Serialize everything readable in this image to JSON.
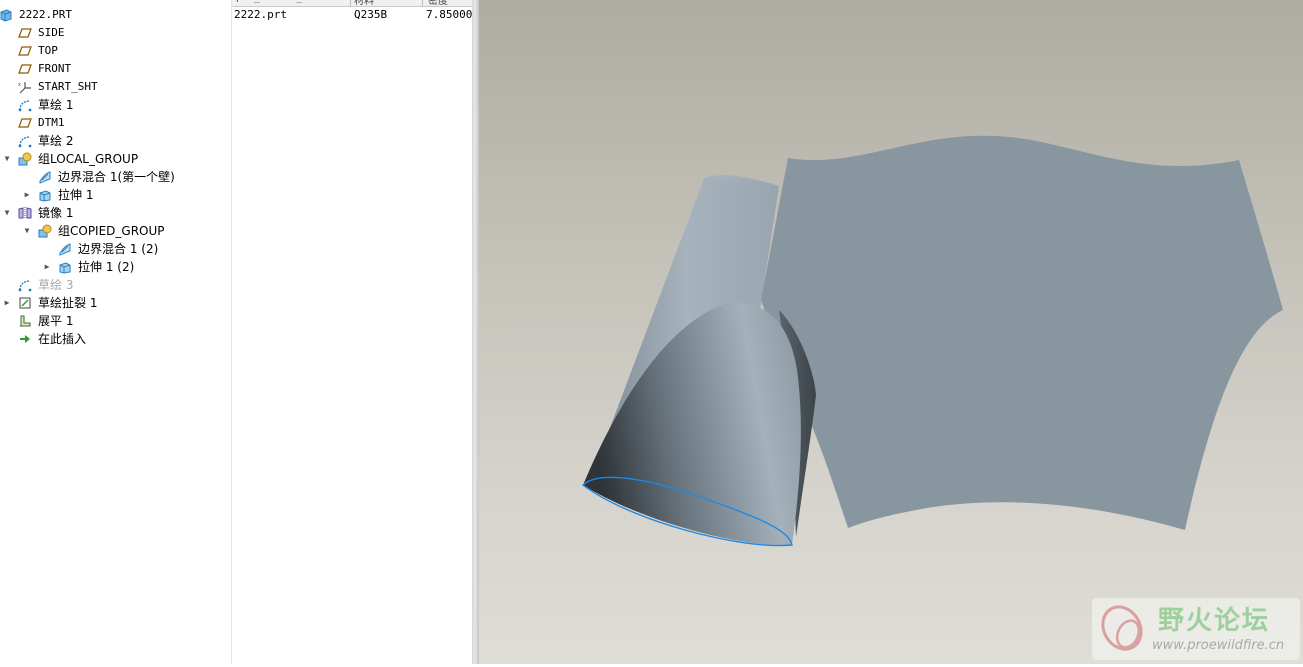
{
  "model_tree": {
    "columns": [
      "ptc_common_name",
      "材料",
      "密度"
    ],
    "items": [
      {
        "label": "2222.PRT",
        "icon": "part-icon",
        "indent": 0,
        "expander": "none",
        "name_value": "2222.prt",
        "material": "Q235B",
        "density": "7.850000"
      },
      {
        "label": "SIDE",
        "icon": "datum-plane-icon",
        "indent": 1,
        "expander": "none"
      },
      {
        "label": "TOP",
        "icon": "datum-plane-icon",
        "indent": 1,
        "expander": "none"
      },
      {
        "label": "FRONT",
        "icon": "datum-plane-icon",
        "indent": 1,
        "expander": "none"
      },
      {
        "label": "START_SHT",
        "icon": "coordinate-system-icon",
        "indent": 1,
        "expander": "none"
      },
      {
        "label": "草绘 1",
        "icon": "sketch-icon",
        "indent": 1,
        "expander": "none"
      },
      {
        "label": "DTM1",
        "icon": "datum-plane-icon",
        "indent": 1,
        "expander": "none"
      },
      {
        "label": "草绘 2",
        "icon": "sketch-icon",
        "indent": 1,
        "expander": "none"
      },
      {
        "label": "组LOCAL_GROUP",
        "icon": "group-icon",
        "indent": 1,
        "expander": "open"
      },
      {
        "label": "边界混合 1(第一个壁)",
        "icon": "boundary-blend-icon",
        "indent": 2,
        "expander": "none"
      },
      {
        "label": "拉伸 1",
        "icon": "extrude-icon",
        "indent": 2,
        "expander": "closed"
      },
      {
        "label": "镜像 1",
        "icon": "mirror-icon",
        "indent": 1,
        "expander": "open"
      },
      {
        "label": "组COPIED_GROUP",
        "icon": "group-icon",
        "indent": 2,
        "expander": "open"
      },
      {
        "label": "边界混合 1 (2)",
        "icon": "boundary-blend-icon",
        "indent": 3,
        "expander": "none"
      },
      {
        "label": "拉伸 1 (2)",
        "icon": "extrude-icon",
        "indent": 3,
        "expander": "closed"
      },
      {
        "label": "草绘 3",
        "icon": "sketch-icon",
        "indent": 1,
        "expander": "none",
        "dim": true
      },
      {
        "label": "草绘扯裂 1",
        "icon": "sketched-rip-icon",
        "indent": 1,
        "expander": "closed"
      },
      {
        "label": "展平 1",
        "icon": "flatten-icon",
        "indent": 1,
        "expander": "none"
      },
      {
        "label": "在此插入",
        "icon": "insert-here-arrow-icon",
        "indent": 1,
        "expander": "none"
      }
    ]
  },
  "watermark": {
    "title": "野火论坛",
    "url": "www.proewildfire.cn"
  },
  "colors": {
    "surface_sheet": "#8896a0",
    "edge_highlight": "#1e88e5",
    "tree_icon_blue": "#2b7fc1"
  }
}
